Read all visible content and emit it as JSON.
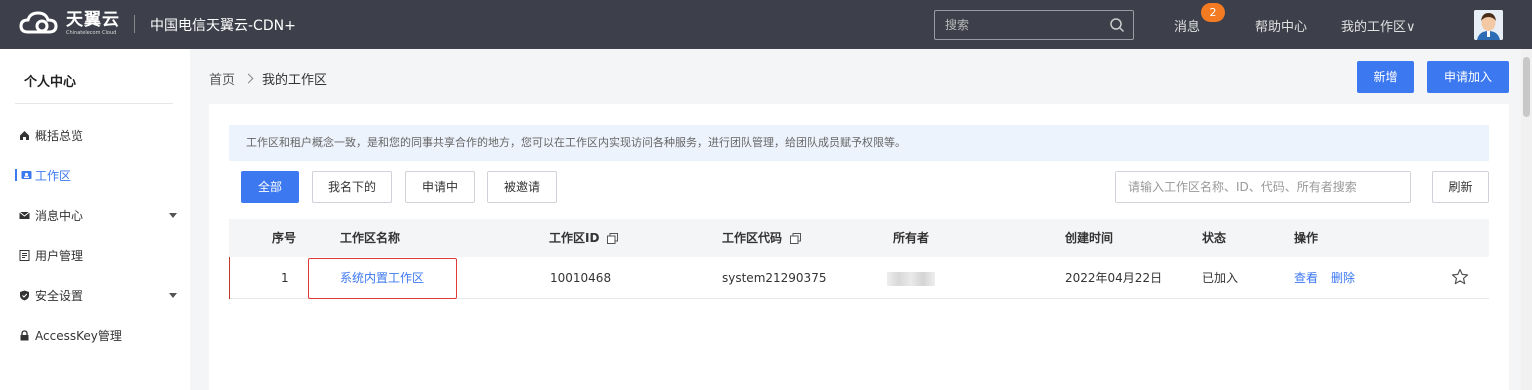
{
  "topbar": {
    "logo_main": "天翼云",
    "logo_sub": "Chinatelecom Cloud",
    "product": "中国电信天翼云-CDN+",
    "search_placeholder": "搜索",
    "messages_label": "消息",
    "messages_count": "2",
    "help_label": "帮助中心",
    "workspace_menu_label": "我的工作区",
    "chevron_glyph": "∨"
  },
  "sidebar": {
    "title": "个人中心",
    "items": [
      {
        "label": "概括总览",
        "icon": "home-icon"
      },
      {
        "label": "工作区",
        "icon": "workspace-icon",
        "active": true
      },
      {
        "label": "消息中心",
        "icon": "mail-icon",
        "expandable": true
      },
      {
        "label": "用户管理",
        "icon": "user-doc-icon"
      },
      {
        "label": "安全设置",
        "icon": "shield-icon",
        "expandable": true
      },
      {
        "label": "AccessKey管理",
        "icon": "lock-icon"
      }
    ]
  },
  "breadcrumb": {
    "home": "首页",
    "current": "我的工作区"
  },
  "actions": {
    "new_label": "新增",
    "apply_label": "申请加入"
  },
  "notice": "工作区和租户概念一致，是和您的同事共享合作的地方，您可以在工作区内实现访问各种服务，进行团队管理，给团队成员赋予权限等。",
  "filters": {
    "all": "全部",
    "mine": "我名下的",
    "applying": "申请中",
    "invited": "被邀请",
    "search_placeholder": "请输入工作区名称、ID、代码、所有者搜索",
    "refresh": "刷新"
  },
  "table": {
    "headers": {
      "index": "序号",
      "name": "工作区名称",
      "id": "工作区ID",
      "code": "工作区代码",
      "owner": "所有者",
      "created": "创建时间",
      "status": "状态",
      "ops": "操作"
    },
    "rows": [
      {
        "index": "1",
        "name": "系统内置工作区",
        "id": "10010468",
        "code": "system21290375",
        "created": "2022年04月22日",
        "status": "已加入",
        "view": "查看",
        "delete": "删除"
      }
    ]
  },
  "colors": {
    "accent": "#3c78f0",
    "topbar": "#3d3f4a",
    "badge": "#f47b22",
    "highlight": "#e03a3a"
  }
}
